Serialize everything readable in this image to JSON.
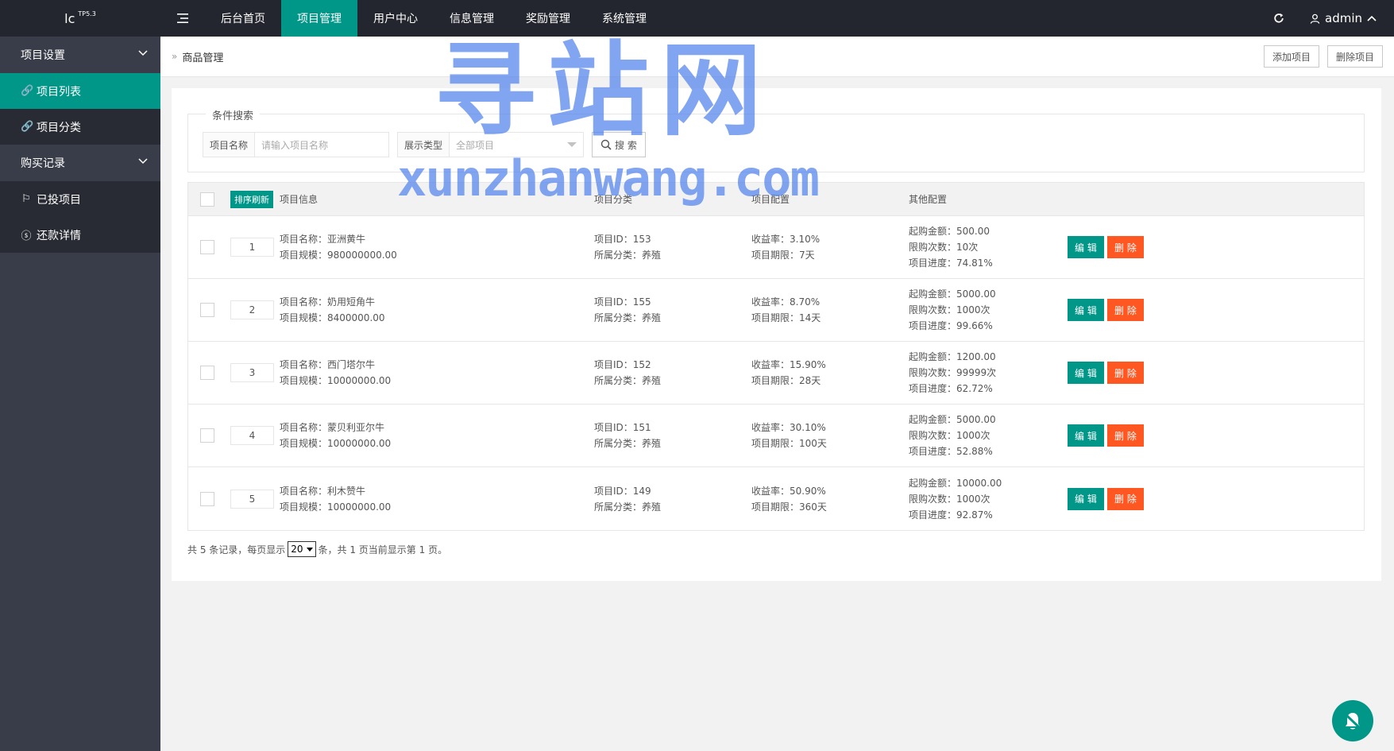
{
  "header": {
    "logo": "lc",
    "logo_version": "TP5.3",
    "nav": [
      {
        "label": "后台首页"
      },
      {
        "label": "项目管理"
      },
      {
        "label": "用户中心"
      },
      {
        "label": "信息管理"
      },
      {
        "label": "奖励管理"
      },
      {
        "label": "系统管理"
      }
    ],
    "user": "admin"
  },
  "sidebar": {
    "groups": [
      {
        "label": "项目设置"
      },
      {
        "label": "购买记录"
      }
    ],
    "items": [
      {
        "label": "项目列表"
      },
      {
        "label": "项目分类"
      },
      {
        "label": "已投项目"
      },
      {
        "label": "还款详情"
      }
    ]
  },
  "breadcrumb": {
    "title": "商品管理",
    "add_button": "添加项目",
    "delete_button": "删除项目"
  },
  "search": {
    "legend": "条件搜索",
    "name_label": "项目名称",
    "name_placeholder": "请输入项目名称",
    "type_label": "展示类型",
    "type_value": "全部项目",
    "search_button": "搜 索"
  },
  "table": {
    "sort_button": "排序刷新",
    "headers": {
      "info": "项目信息",
      "category": "项目分类",
      "config": "项目配置",
      "other": "其他配置"
    },
    "edit_label": "编 辑",
    "delete_label": "删 除",
    "rows": [
      {
        "sort": "1",
        "name": "项目名称：亚洲黄牛",
        "scale": "项目规模：980000000.00",
        "pid": "项目ID：153",
        "cat": "所属分类：养殖",
        "rate": "收益率：3.10%",
        "term": "项目期限：7天",
        "min": "起购金额：500.00",
        "limit": "限购次数：10次",
        "progress": "项目进度：74.81%"
      },
      {
        "sort": "2",
        "name": "项目名称：奶用短角牛",
        "scale": "项目规模：8400000.00",
        "pid": "项目ID：155",
        "cat": "所属分类：养殖",
        "rate": "收益率：8.70%",
        "term": "项目期限：14天",
        "min": "起购金额：5000.00",
        "limit": "限购次数：1000次",
        "progress": "项目进度：99.66%"
      },
      {
        "sort": "3",
        "name": "项目名称：西门塔尔牛",
        "scale": "项目规模：10000000.00",
        "pid": "项目ID：152",
        "cat": "所属分类：养殖",
        "rate": "收益率：15.90%",
        "term": "项目期限：28天",
        "min": "起购金额：1200.00",
        "limit": "限购次数：99999次",
        "progress": "项目进度：62.72%"
      },
      {
        "sort": "4",
        "name": "项目名称：蒙贝利亚尔牛",
        "scale": "项目规模：10000000.00",
        "pid": "项目ID：151",
        "cat": "所属分类：养殖",
        "rate": "收益率：30.10%",
        "term": "项目期限：100天",
        "min": "起购金额：5000.00",
        "limit": "限购次数：1000次",
        "progress": "项目进度：52.88%"
      },
      {
        "sort": "5",
        "name": "项目名称：利木赞牛",
        "scale": "项目规模：10000000.00",
        "pid": "项目ID：149",
        "cat": "所属分类：养殖",
        "rate": "收益率：50.90%",
        "term": "项目期限：360天",
        "min": "起购金额：10000.00",
        "limit": "限购次数：1000次",
        "progress": "项目进度：92.87%"
      }
    ]
  },
  "pager": {
    "prefix": "共 5 条记录，每页显示",
    "per_page": "20",
    "suffix": "条，共 1 页当前显示第 1 页。"
  },
  "watermark": {
    "cn": "寻站网",
    "en": "xunzhanwang.com"
  },
  "colors": {
    "accent": "#009688",
    "danger": "#ff5722",
    "header_bg": "#23262e",
    "sidebar_bg": "#393d49",
    "watermark": "#5082eb"
  }
}
